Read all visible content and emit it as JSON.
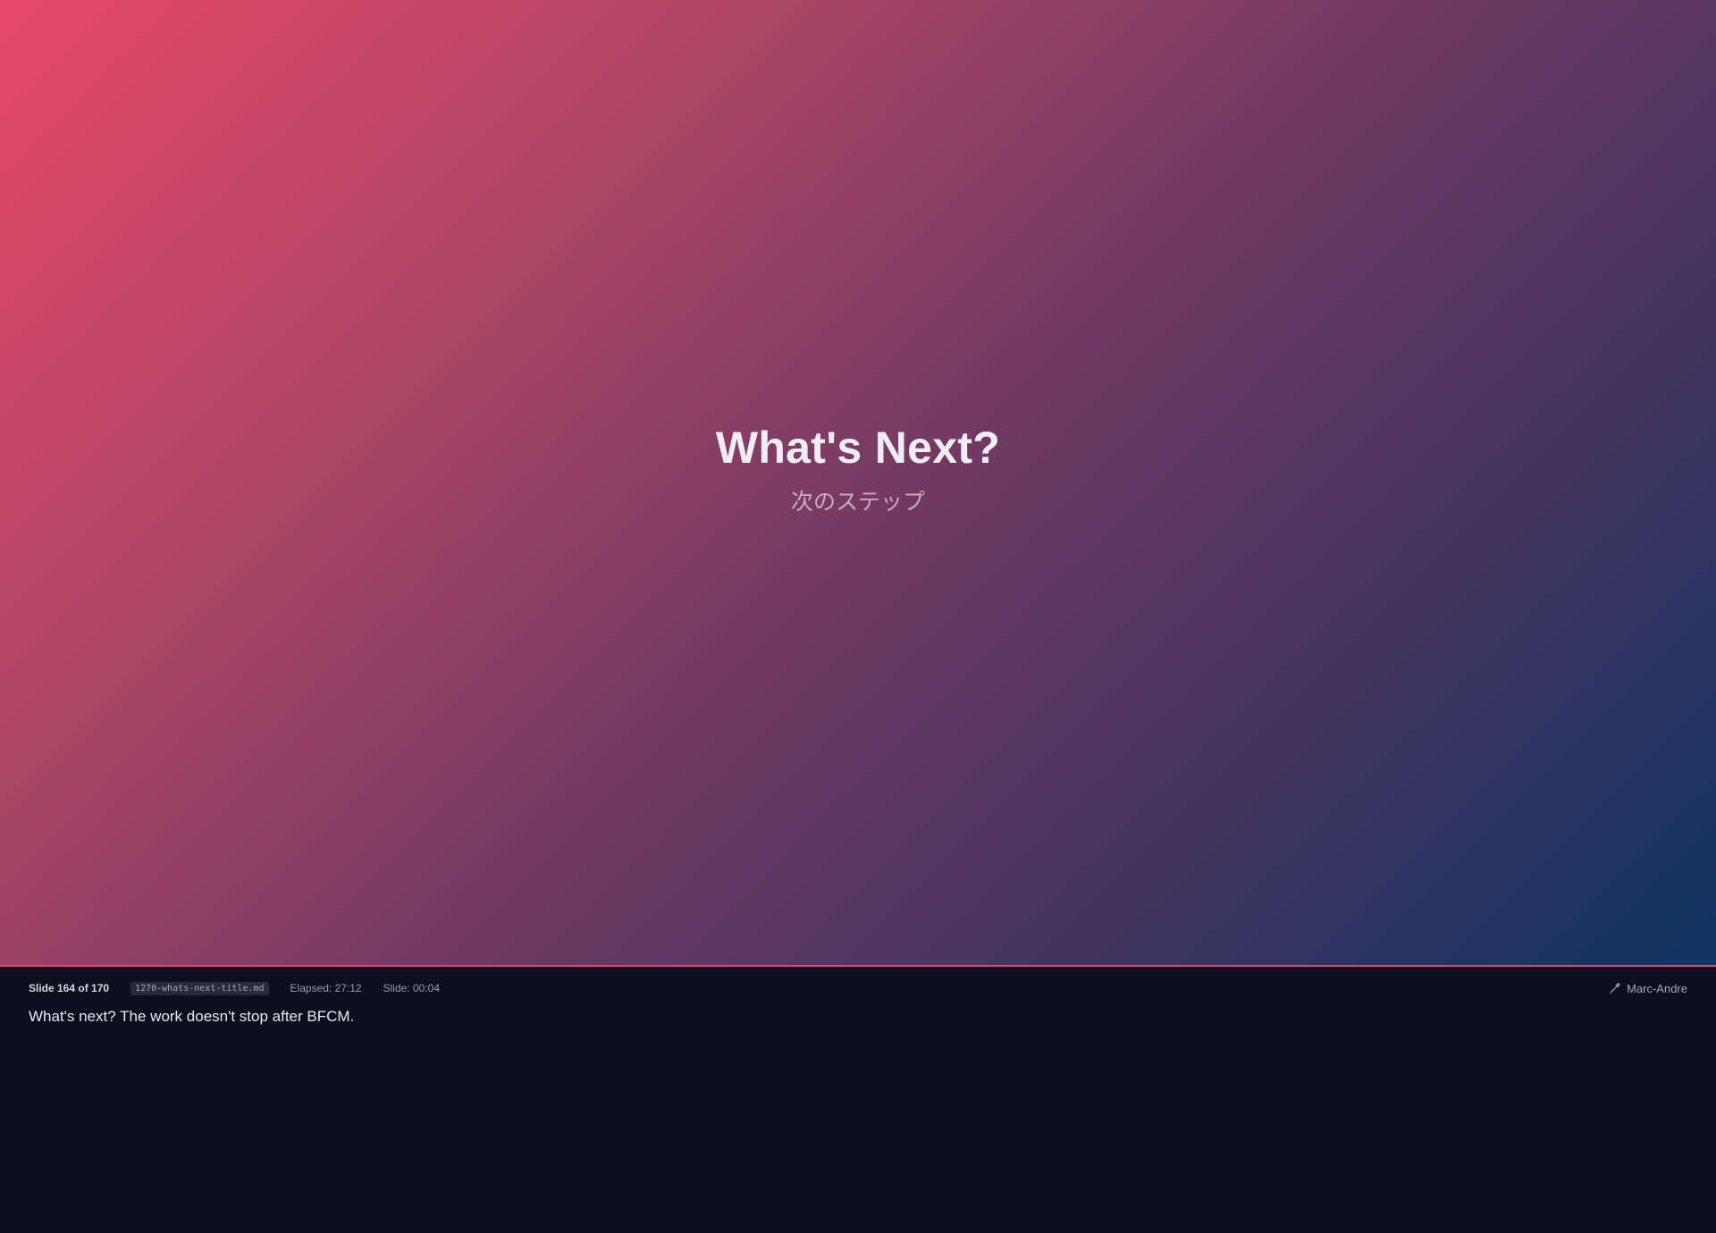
{
  "slide": {
    "title": "What's Next?",
    "subtitle": "次のステップ"
  },
  "presenter": {
    "slide_counter": "Slide 164 of 170",
    "file_name": "1270-whats-next-title.md",
    "elapsed": "Elapsed: 27:12",
    "slide_time": "Slide: 00:04",
    "speaker_name": "Marc-Andre",
    "speaker_icon": "microphone-icon",
    "notes": "What's next? The work doesn't stop after BFCM."
  },
  "colors": {
    "gradient_start": "#e84868",
    "gradient_end": "#0f3463",
    "panel_background": "#0e0e1f",
    "accent_border": "#e84868"
  }
}
